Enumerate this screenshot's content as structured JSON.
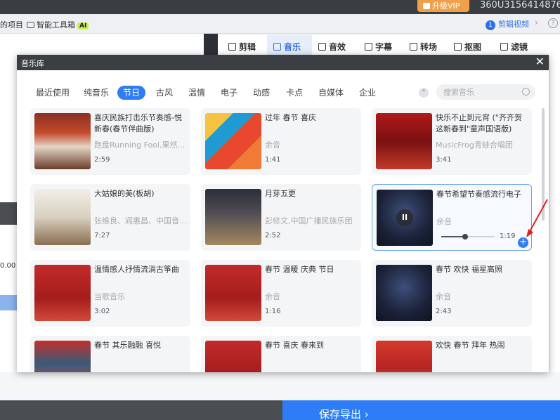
{
  "topbar": {
    "vip_label": "升级VIP",
    "user_id": "360U3156414876"
  },
  "toolbar": {
    "item1": "的项目",
    "item2": "智能工具箱",
    "ai_badge": "AI",
    "help_num": "1",
    "help_link": "剪辑视频",
    "arrow": "›",
    "question": "?"
  },
  "editor_tabs": [
    {
      "label": "剪辑",
      "icon": "clip-icon"
    },
    {
      "label": "音乐",
      "icon": "music-icon",
      "active": true
    },
    {
      "label": "音效",
      "icon": "sound-effect-icon"
    },
    {
      "label": "字幕",
      "icon": "subtitle-icon"
    },
    {
      "label": "转场",
      "icon": "transition-icon"
    },
    {
      "label": "抠图",
      "icon": "cutout-icon"
    },
    {
      "label": "滤镜",
      "icon": "filter-icon"
    }
  ],
  "background": {
    "left_time": "0.00",
    "export_label": "保存导出 ›"
  },
  "modal": {
    "title": "音乐库",
    "close": "✕",
    "categories": [
      "最近使用",
      "纯音乐",
      "节日",
      "古风",
      "温情",
      "电子",
      "动感",
      "卡点",
      "自媒体",
      "企业"
    ],
    "active_category": "节日",
    "collapse": "⌃",
    "search_placeholder": "搜索音乐",
    "songs": [
      {
        "title": "喜庆民族打击乐节奏感-悦新春(春节伴曲版)",
        "artist": "跑盘Running Fool,果然...",
        "duration": "2:59"
      },
      {
        "title": "过年 春节 喜庆",
        "artist": "余音",
        "duration": "1:41"
      },
      {
        "title": "快乐不止到元宵 (\"齐齐贺这新春到\"童声国语版)",
        "artist": "MusicFrog青蛙合唱团",
        "duration": "3:41"
      },
      {
        "title": "大姑娘的美(板胡)",
        "artist": "张维良、阎惠昌、中国音...",
        "duration": "7:27"
      },
      {
        "title": "月芽五更",
        "artist": "彭修文,中国广播民族乐团",
        "duration": "2:52"
      },
      {
        "title": "春节希望节奏感流行电子",
        "artist": "余音",
        "duration": "1:19",
        "playing": true,
        "progress": 0.45
      },
      {
        "title": "温情感人抒情流淌古筝曲",
        "artist": "当歌音乐",
        "duration": "3:02"
      },
      {
        "title": "春节 温暖 庆典 节日",
        "artist": "余音",
        "duration": "1:16"
      },
      {
        "title": "春节 欢快 福星高照",
        "artist": "余音",
        "duration": "2:43"
      },
      {
        "title": "春节 其乐融融 喜悦",
        "artist": "",
        "duration": ""
      },
      {
        "title": "春节 喜庆 春来到",
        "artist": "",
        "duration": ""
      },
      {
        "title": "欢快 春节 拜年 热闹",
        "artist": "",
        "duration": ""
      }
    ],
    "pause_symbol": "II",
    "add_symbol": "+"
  },
  "colors": {
    "accent": "#2e7cf6",
    "vip": "#f0a04b",
    "header": "#3b3e43"
  }
}
